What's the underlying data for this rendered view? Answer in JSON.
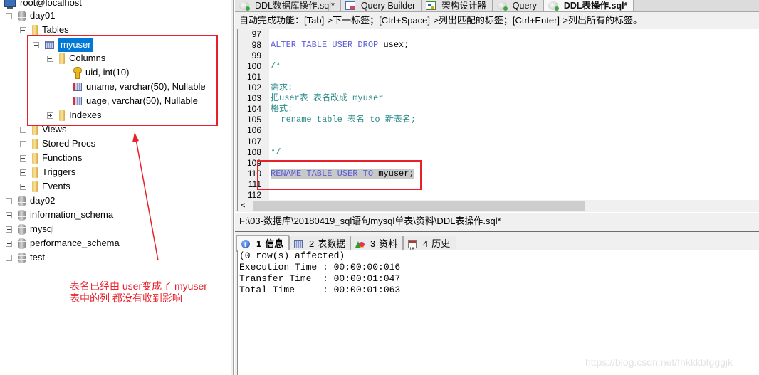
{
  "object_browser": {
    "connection": "root@localhost",
    "databases": [
      {
        "name": "day01",
        "expanded": true
      },
      {
        "name": "day02"
      },
      {
        "name": "information_schema"
      },
      {
        "name": "mysql"
      },
      {
        "name": "performance_schema"
      },
      {
        "name": "test"
      }
    ],
    "day01_children": {
      "tables_label": "Tables",
      "table": {
        "name": "myuser",
        "columns_label": "Columns",
        "columns": [
          {
            "text": "uid, int(10)",
            "icon": "primary-key-icon"
          },
          {
            "text": "uname, varchar(50), Nullable",
            "icon": "column-icon"
          },
          {
            "text": "uage, varchar(50), Nullable",
            "icon": "column-icon"
          }
        ],
        "indexes_label": "Indexes"
      },
      "folders": [
        "Views",
        "Stored Procs",
        "Functions",
        "Triggers",
        "Events"
      ]
    }
  },
  "annotation": {
    "line1": "表名已经由 user变成了 myuser",
    "line2": "表中的列 都没有收到影响",
    "color": "#e8202a"
  },
  "tabs": [
    {
      "label": "DDL数据库操作.sql*",
      "icon": "sql-file-icon",
      "active": false
    },
    {
      "label": "Query Builder",
      "icon": "query-builder-icon",
      "active": false
    },
    {
      "label": "架构设计器",
      "icon": "schema-designer-icon",
      "active": false
    },
    {
      "label": "Query",
      "icon": "sql-file-icon",
      "active": false
    },
    {
      "label": "DDL表操作.sql*",
      "icon": "sql-file-icon",
      "active": true
    }
  ],
  "hint_bar": "自动完成功能：[Tab]->下一标签；[Ctrl+Space]->列出匹配的标签；[Ctrl+Enter]->列出所有的标签。",
  "editor": {
    "lines": [
      {
        "no": "97",
        "parts": []
      },
      {
        "no": "98",
        "parts": [
          {
            "t": "ALTER TABLE USER DROP ",
            "c": "kw"
          },
          {
            "t": "usex;",
            "c": "id"
          }
        ]
      },
      {
        "no": "99",
        "parts": []
      },
      {
        "no": "100",
        "parts": [
          {
            "t": "/*",
            "c": "cm"
          }
        ]
      },
      {
        "no": "101",
        "parts": []
      },
      {
        "no": "102",
        "parts": [
          {
            "t": "需求:",
            "c": "cm"
          }
        ]
      },
      {
        "no": "103",
        "parts": [
          {
            "t": "把user表 表名改成 myuser",
            "c": "cm"
          }
        ]
      },
      {
        "no": "104",
        "parts": [
          {
            "t": "格式:",
            "c": "cm"
          }
        ]
      },
      {
        "no": "105",
        "parts": [
          {
            "t": "  rename table 表名 to 新表名;",
            "c": "cm"
          }
        ]
      },
      {
        "no": "106",
        "parts": []
      },
      {
        "no": "107",
        "parts": []
      },
      {
        "no": "108",
        "parts": [
          {
            "t": "*/",
            "c": "cm"
          }
        ]
      },
      {
        "no": "109",
        "parts": []
      },
      {
        "no": "110",
        "parts": [
          {
            "t": "RENAME TABLE USER TO ",
            "c": "kw sel"
          },
          {
            "t": "myuser;",
            "c": "id sel"
          }
        ]
      },
      {
        "no": "111",
        "parts": []
      },
      {
        "no": "112",
        "parts": []
      }
    ]
  },
  "scrollbar": {
    "left_arrow": "<"
  },
  "file_path": "F:\\03-数据库\\20180419_sql语句mysql单表\\资料\\DDL表操作.sql*",
  "result_tabs": [
    {
      "num": "1",
      "label": "信息",
      "icon": "info-icon",
      "active": true
    },
    {
      "num": "2",
      "label": "表数据",
      "icon": "table-data-icon",
      "active": false
    },
    {
      "num": "3",
      "label": "资料",
      "icon": "resources-icon",
      "active": false
    },
    {
      "num": "4",
      "label": "历史",
      "icon": "history-calendar-icon",
      "active": false
    }
  ],
  "result_output": [
    "(0 row(s) affected)",
    "Execution Time : 00:00:00:016",
    "Transfer Time  : 00:00:01:047",
    "Total Time     : 00:00:01:063"
  ],
  "watermark": "https://blog.csdn.net/fhkkkbfgggjk"
}
